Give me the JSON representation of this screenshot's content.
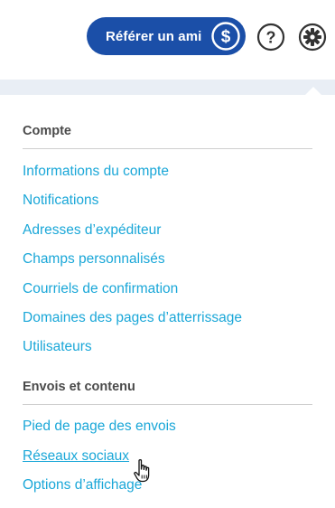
{
  "header": {
    "refer_label": "Référer un ami",
    "icons": [
      "dollar-icon",
      "help-icon",
      "gear-icon"
    ]
  },
  "colors": {
    "refer_button": "#1b4fa8",
    "link": "#1aa7d8",
    "section_title": "#4a4a4a",
    "band": "#e9eef5"
  },
  "menu": {
    "sections": [
      {
        "title": "Compte",
        "items": [
          "Informations du compte",
          "Notifications",
          "Adresses d’expéditeur",
          "Champs personnalisés",
          "Courriels de confirmation",
          "Domaines des pages d’atterrissage",
          "Utilisateurs"
        ]
      },
      {
        "title": "Envois et contenu",
        "items": [
          "Pied de page des envois",
          "Réseaux sociaux",
          "Options d’affichage"
        ]
      }
    ],
    "hovered_item": "Réseaux sociaux"
  }
}
